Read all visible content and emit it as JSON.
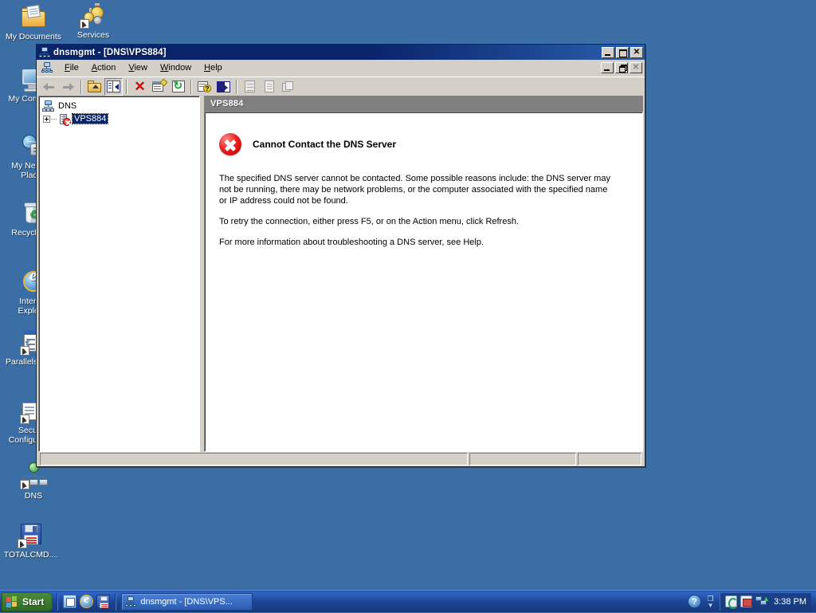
{
  "desktop": {
    "icons": [
      {
        "label": "My Documents",
        "icon": "my-documents-icon"
      },
      {
        "label": "Services",
        "icon": "services-icon"
      },
      {
        "label": "My Computer",
        "icon": "my-computer-icon"
      },
      {
        "label": "My Network Places",
        "icon": "my-network-places-icon"
      },
      {
        "label": "Recycle Bin",
        "icon": "recycle-bin-icon"
      },
      {
        "label": "Internet Explorer",
        "icon": "internet-explorer-icon"
      },
      {
        "label": "Parallels Panel",
        "icon": "parallels-panel-icon"
      },
      {
        "label": "Security Configuration",
        "icon": "security-configuration-icon"
      },
      {
        "label": "DNS",
        "icon": "dns-shortcut-icon"
      },
      {
        "label": "TOTALCMD....",
        "icon": "totalcmd-icon"
      }
    ],
    "background_color": "#3a6ea5"
  },
  "window": {
    "title": "dnsmgmt - [DNS\\VPS884]",
    "icon": "mmc-console-icon",
    "titlebar_color": "#0a246a",
    "controls": {
      "minimize": "_",
      "maximize": "□",
      "close": "✕"
    },
    "mdi_controls": {
      "minimize": "_",
      "restore": "❐",
      "close": "✕"
    },
    "menu": [
      {
        "label": "File",
        "accel": "F"
      },
      {
        "label": "Action",
        "accel": "A"
      },
      {
        "label": "View",
        "accel": "V"
      },
      {
        "label": "Window",
        "accel": "W"
      },
      {
        "label": "Help",
        "accel": "H"
      }
    ],
    "toolbar": [
      {
        "name": "back-button",
        "icon": "arrow-left-icon",
        "enabled": false
      },
      {
        "name": "forward-button",
        "icon": "arrow-right-icon",
        "enabled": false
      },
      {
        "name": "up-one-level-button",
        "icon": "up-folder-icon",
        "enabled": true
      },
      {
        "name": "show-hide-console-tree-button",
        "icon": "console-tree-icon",
        "enabled": true,
        "pressed": true
      },
      {
        "name": "delete-button",
        "icon": "delete-x-icon",
        "enabled": true
      },
      {
        "name": "properties-button",
        "icon": "properties-icon",
        "enabled": true
      },
      {
        "name": "refresh-button",
        "icon": "refresh-icon",
        "enabled": true
      },
      {
        "name": "help-button",
        "icon": "help-icon",
        "enabled": true
      },
      {
        "name": "show-pane-button",
        "icon": "show-pane-icon",
        "enabled": true
      },
      {
        "name": "new-server-button",
        "icon": "server-gray-icon",
        "enabled": false
      },
      {
        "name": "list-gray-button",
        "icon": "list-gray-icon",
        "enabled": false
      },
      {
        "name": "windows-gray-button",
        "icon": "windows-gray-icon",
        "enabled": false
      }
    ]
  },
  "tree": {
    "root": {
      "label": "DNS",
      "icon": "dns-console-root-icon"
    },
    "nodes": [
      {
        "label": "VPS884",
        "icon": "server-error-icon",
        "expander": "+",
        "selected": true
      }
    ]
  },
  "result_pane": {
    "header": "VPS884",
    "error": {
      "icon": "error-circle-icon",
      "title": "Cannot Contact the DNS Server",
      "paragraphs": [
        "The specified DNS server cannot be contacted. Some possible reasons include: the DNS server may not be running, there may be network problems, or the computer associated with the specified name or IP address could not be found.",
        "To retry the connection, either press F5, or on the Action menu, click Refresh.",
        "For more information about troubleshooting a DNS server, see Help."
      ]
    }
  },
  "status_bar": {
    "pane1": "",
    "pane2": "",
    "pane3": ""
  },
  "taskbar": {
    "start_label": "Start",
    "quick_launch": [
      {
        "name": "show-desktop-icon",
        "label": "Show Desktop"
      },
      {
        "name": "internet-explorer-icon",
        "label": "Internet Explorer"
      },
      {
        "name": "save-floppy-icon",
        "label": "Save"
      }
    ],
    "tasks": [
      {
        "label": "dnsmgmt - [DNS\\VPS...",
        "icon": "mmc-console-icon",
        "active": true
      }
    ],
    "tray": {
      "help_icon": "?",
      "toggle_icon": "toggle-arrow-icon",
      "icons": [
        {
          "name": "tray-green-icon"
        },
        {
          "name": "tray-monitor-icon"
        },
        {
          "name": "tray-network-icon"
        }
      ],
      "clock": "3:38 PM"
    }
  }
}
